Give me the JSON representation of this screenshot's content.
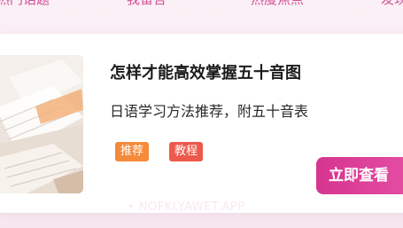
{
  "top_tabs": [
    "热门话题",
    "我留言",
    "热度焦点",
    "发现"
  ],
  "card": {
    "title": "怎样才能高效掌握五十音图",
    "subtitle": "日语学习方法推荐，附五十音表",
    "tags": [
      "推荐",
      "教程"
    ],
    "cta_label": "立即查看",
    "thumbnail": "study-desk-photo"
  },
  "watermark": "• NOFKLYAWET.APP",
  "colors": {
    "accent": "#d6358f",
    "tag_recommend": "#f58a3b",
    "tag_tutorial": "#ed5a4b",
    "tab_text": "#d24f9a"
  }
}
